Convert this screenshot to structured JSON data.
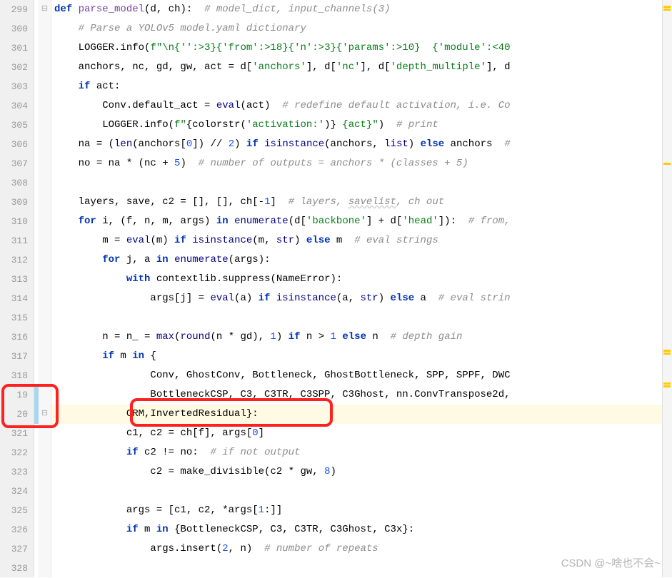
{
  "gutter": {
    "lines": [
      "299",
      "300",
      "301",
      "302",
      "303",
      "304",
      "305",
      "306",
      "307",
      "308",
      "309",
      "310",
      "311",
      "312",
      "313",
      "314",
      "315",
      "316",
      "317",
      "318",
      "19",
      "20",
      "321",
      "322",
      "323",
      "324",
      "325",
      "326",
      "327",
      "328"
    ]
  },
  "changes": {
    "modified_indices": [
      20,
      21
    ]
  },
  "code": {
    "l0": {
      "pre": "",
      "a": "def",
      "b": " parse_model",
      "c": "(d",
      "d": ", ch):  ",
      "e": "# model_dict, input_channels(3)"
    },
    "l1": {
      "pre": "    ",
      "a": "# Parse a YOLOv5 model.yaml dictionary"
    },
    "l2": {
      "pre": "    ",
      "a": "LOGGER.info(",
      "b": "f\"\\n{'':>3}{'from':>18}{'n':>3}{'params':>10}  {'module':<40",
      "c": ""
    },
    "l3": {
      "pre": "    ",
      "a": "anchors, nc, gd, gw, act = d[",
      "b": "'anchors'",
      "c": "], d[",
      "d": "'nc'",
      "e": "], d[",
      "f": "'depth_multiple'",
      "g": "], d"
    },
    "l4": {
      "pre": "    ",
      "a": "if",
      "b": " act:"
    },
    "l5": {
      "pre": "        ",
      "a": "Conv.default_act = ",
      "b": "eval",
      "c": "(act)  ",
      "d": "# redefine default activation, i.e. Co"
    },
    "l6": {
      "pre": "        ",
      "a": "LOGGER.info(",
      "b": "f\"",
      "c": "{colorstr(",
      "d": "'activation:'",
      "e": ")}",
      " f": " {act}",
      "g": "\"",
      ")": ")  ",
      "h": "# print"
    },
    "l7": {
      "pre": "    ",
      "a": "na = (",
      "b": "len",
      "c": "(anchors[",
      "d": "0",
      "e": "]) // ",
      "f": "2",
      "g": ") ",
      "h": "if",
      "i": " ",
      "j": "isinstance",
      "k": "(anchors, ",
      "l": "list",
      "m": ") ",
      "n": "else",
      "o": " anchors  ",
      "p": "#"
    },
    "l8": {
      "pre": "    ",
      "a": "no = na * (nc + ",
      "b": "5",
      "c": ")  ",
      "d": "# number of outputs = anchors * (classes + 5)"
    },
    "l9": {
      "pre": ""
    },
    "l10": {
      "pre": "    ",
      "a": "layers, save, c2 = [], [], ch[-",
      "b": "1",
      "c": "]  ",
      "d": "# layers, ",
      "e": "savelist",
      "f": ", ch out"
    },
    "l11": {
      "pre": "    ",
      "a": "for",
      "b": " i, (f, n, m, args) ",
      "c": "in",
      "d": " ",
      "e": "enumerate",
      "f": "(d[",
      "g": "'backbone'",
      "h": "] + d[",
      "i": "'head'",
      "j": "]):  ",
      "k": "# from,"
    },
    "l12": {
      "pre": "        ",
      "a": "m = ",
      "b": "eval",
      "c": "(m) ",
      "d": "if",
      "e": " ",
      "f": "isinstance",
      "g": "(m, ",
      "h": "str",
      "i": ") ",
      "j": "else",
      "k": " m  ",
      "l": "# eval strings"
    },
    "l13": {
      "pre": "        ",
      "a": "for",
      "b": " j, a ",
      "c": "in",
      "d": " ",
      "e": "enumerate",
      "f": "(args):"
    },
    "l14": {
      "pre": "            ",
      "a": "with",
      "b": " contextlib.suppress(NameError):"
    },
    "l15": {
      "pre": "                ",
      "a": "args[j] = ",
      "b": "eval",
      "c": "(a) ",
      "d": "if",
      "e": " ",
      "f": "isinstance",
      "g": "(a, ",
      "h": "str",
      "i": ") ",
      "j": "else",
      "k": " a  ",
      "l": "# eval strin"
    },
    "l16": {
      "pre": ""
    },
    "l17": {
      "pre": "        ",
      "a": "n = n_ = ",
      "b": "max",
      "c": "(",
      "d": "round",
      "e": "(n * gd), ",
      "f": "1",
      "g": ") ",
      "h": "if",
      "i": " n > ",
      "j": "1",
      "k": " ",
      "l": "else",
      "m": " n  ",
      "n": "# depth gain"
    },
    "l18": {
      "pre": "        ",
      "a": "if",
      "b": " m ",
      "c": "in",
      "d": " {"
    },
    "l19": {
      "pre": "                ",
      "a": "Conv, GhostConv, Bottleneck, GhostBottleneck, SPP, SPPF, DWC"
    },
    "l20": {
      "pre": "                ",
      "a": "BottleneckCSP, C3, C3TR, C3SPP, C3Ghost, nn.ConvTranspose2d,"
    },
    "l21": {
      "pre": "            ",
      "a": "CRM,InvertedResidual}:"
    },
    "l22": {
      "pre": "            ",
      "a": "c1, c2 = ch[f], args[",
      "b": "0",
      "c": "]"
    },
    "l23": {
      "pre": "            ",
      "a": "if",
      "b": " c2 != no:  ",
      "c": "# if not output"
    },
    "l24": {
      "pre": "                ",
      "a": "c2 = make_divisible(c2 * gw, ",
      "b": "8",
      "c": ")"
    },
    "l25": {
      "pre": ""
    },
    "l26": {
      "pre": "            ",
      "a": "args = [c1, c2, *args[",
      "b": "1",
      "c": ":]]"
    },
    "l27": {
      "pre": "            ",
      "a": "if",
      "b": " m ",
      "c": "in",
      "d": " {BottleneckCSP, C3, C3TR, C3Ghost, C3x}:"
    },
    "l28": {
      "pre": "                ",
      "a": "args.insert(",
      "b": "2",
      "c": ", n)  ",
      "d": "# number of repeats"
    },
    "l29": {
      "pre": "                "
    }
  },
  "watermark": "CSDN @~啥也不会~"
}
